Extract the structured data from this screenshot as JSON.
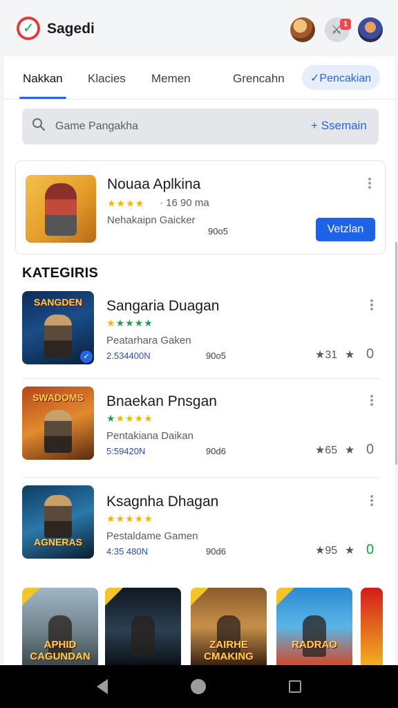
{
  "header": {
    "app_title": "Sagedi",
    "logo_icon": "app-logo-icon",
    "notification_count": "1",
    "colors": {
      "accent": "#2563eb",
      "badge": "#f0484a"
    }
  },
  "tabs": [
    {
      "label": "Nakkan",
      "active": true
    },
    {
      "label": "Klacies"
    },
    {
      "label": "Memen"
    },
    {
      "label": "Grencahn"
    },
    {
      "label": "Pencakian",
      "pill": true,
      "prefix": "✓"
    }
  ],
  "search": {
    "placeholder": "Game Pangakha",
    "action_label": "+ Ssemain"
  },
  "featured": {
    "title": "Nouaa Aplkina",
    "stars": "★★★★",
    "rating_text": "· 16 90 ma",
    "subtitle": "Nehakaipn Gaicker",
    "size": "90o5",
    "install_label": "Vetzlan"
  },
  "section_title": "KATEGIRIS",
  "games": [
    {
      "title": "Sangaria Duagan",
      "thumb_text": "SANGDEN",
      "stars": "★★★★★",
      "star_color": "yellow-first-green",
      "subtitle": "Peatarhara Gaken",
      "downloads": "2.534400N",
      "size": "90o5",
      "rating_count": "★31",
      "score": "0"
    },
    {
      "title": "Bnaekan Pnsgan",
      "thumb_text": "SWADOMS",
      "stars": "★★★★★",
      "star_color": "green-first-yellow",
      "subtitle": "Pentakiana Daikan",
      "downloads": "5:59420N",
      "size": "90d6",
      "rating_count": "★65",
      "score": "0"
    },
    {
      "title": "Ksagnha Dhagan",
      "thumb_text": "AGNERAS",
      "stars": "★★★★★",
      "star_color": "yellow",
      "subtitle": "Pestaldame Gamen",
      "downloads": "4:35 480N",
      "size": "90d6",
      "rating_count": "★95",
      "score": "0"
    }
  ],
  "carousel": [
    {
      "label": "APHID CAGUNDAN"
    },
    {
      "label": ""
    },
    {
      "label": "ZAIRHE CMAKING"
    },
    {
      "label": "RADRAO"
    },
    {
      "label": ""
    }
  ]
}
